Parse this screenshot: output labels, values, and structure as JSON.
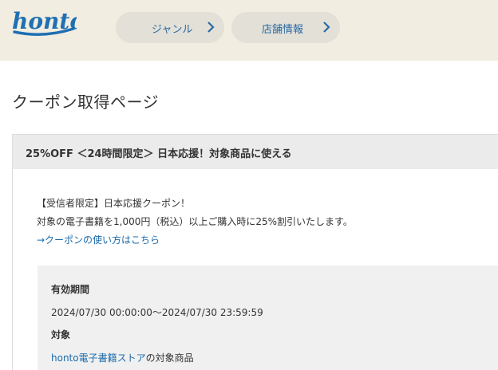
{
  "header": {
    "logo_text": "honto",
    "nav": [
      {
        "label": "ジャンル"
      },
      {
        "label": "店舗情報"
      }
    ]
  },
  "page": {
    "title": "クーポン取得ページ"
  },
  "coupon": {
    "heading": "25%OFF ＜24時間限定＞ 日本応援！対象商品に使える",
    "line1": "【受信者限定】日本応援クーポン！",
    "line2": "対象の電子書籍を1,000円（税込）以上ご購入時に25%割引いたします。",
    "howto_link": "→クーポンの使い方はこちら",
    "period_label": "有効期間",
    "period_value": "2024/07/30 00:00:00～2024/07/30 23:59:59",
    "target_label": "対象",
    "target_link": "honto電子書籍ストア",
    "target_suffix": "の対象商品"
  },
  "colors": {
    "header_bg": "#f1ede1",
    "pill_bg": "#e3e0d7",
    "link": "#1a6aab",
    "logo": "#1f6fb2"
  }
}
